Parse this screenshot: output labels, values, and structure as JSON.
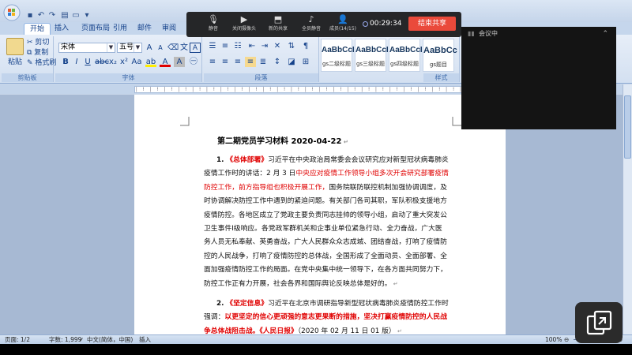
{
  "word": {
    "tabs": [
      "开始",
      "插入",
      "页面布局",
      "引用",
      "邮件",
      "审阅"
    ],
    "clipboard": {
      "paste": "粘贴",
      "cut": "剪切",
      "copy": "复制",
      "format_painter": "格式刷",
      "label": "剪贴板"
    },
    "font": {
      "name": "宋体",
      "size": "五号",
      "label": "字体"
    },
    "paragraph": {
      "label": "段落"
    },
    "styles": {
      "label": "样式",
      "items": [
        {
          "sample": "AaBbCcI",
          "name": "gs二级标题"
        },
        {
          "sample": "AaBbCcI",
          "name": "gs三级标题"
        },
        {
          "sample": "AaBbCcI",
          "name": "gs四级标题"
        },
        {
          "sample": "AaBbCc",
          "name": "gs题目"
        }
      ]
    }
  },
  "document": {
    "title": "第二期党员学习材料 2020-04-22",
    "p1": {
      "num": "1.",
      "tag": "《总体部署》",
      "a": "习近平在中央政治局常委会会议研究应对新型冠状病毒肺炎疫情工作时的讲话：2 月 3 日",
      "red": "中央应对疫情工作领导小组多次开会研究部署疫情防控工作，前方指导组也积极开展工作，",
      "b": "国务院联防联控机制加强协调调度，及时协调解决防控工作中遇到的紧迫问题。有关部门各司其职，军队积极支援地方疫情防控。各地区成立了党政主要负责同志挂帅的领导小组，启动了重大突发公卫生事件Ⅰ级响应。各党政军群机关和企事业单位紧急行动、全力奋战，广大医务人员无私奉献、英勇奋战，广大人民群众众志成城、团结奋战，打响了疫情防控的人民战争，打响了疫情防控的总体战，全国形成了全面动员、全面部署、全面加强疫情防控工作的局面。在党中央集中统一领导下，在各方面共同努力下，防控工作正有力开展，社会各界和国际舆论反映总体是好的。"
    },
    "p2": {
      "num": "2.",
      "tag": "《坚定信息》",
      "a": "习近平在北京市调研指导新型冠状病毒肺炎疫情防控工作时强调：",
      "bold": "以更坚定的信心更顽强的意志更果断的措施，坚决打赢疫情防控的人民战争总体战阻击战。",
      "src": "《人民日报》",
      "date": "（2020 年 02 月 11 日 01 版）"
    }
  },
  "status": {
    "page": "页面: 1/2",
    "words": "字数: 1,999",
    "lang": "中文(简体，中国)",
    "mode": "插入",
    "zoom": "100%"
  },
  "meeting": {
    "tools": [
      {
        "icon": "microphone-icon",
        "label": "静音"
      },
      {
        "icon": "camera-icon",
        "label": "关闭摄像头"
      },
      {
        "icon": "share-screen-icon",
        "label": "新的共享"
      },
      {
        "icon": "mute-all-icon",
        "label": "全员静音"
      },
      {
        "icon": "members-icon",
        "label": "成员(14/15)"
      }
    ],
    "timer": "00:29:34",
    "end": "结束共享",
    "panel_title": "会议中"
  }
}
